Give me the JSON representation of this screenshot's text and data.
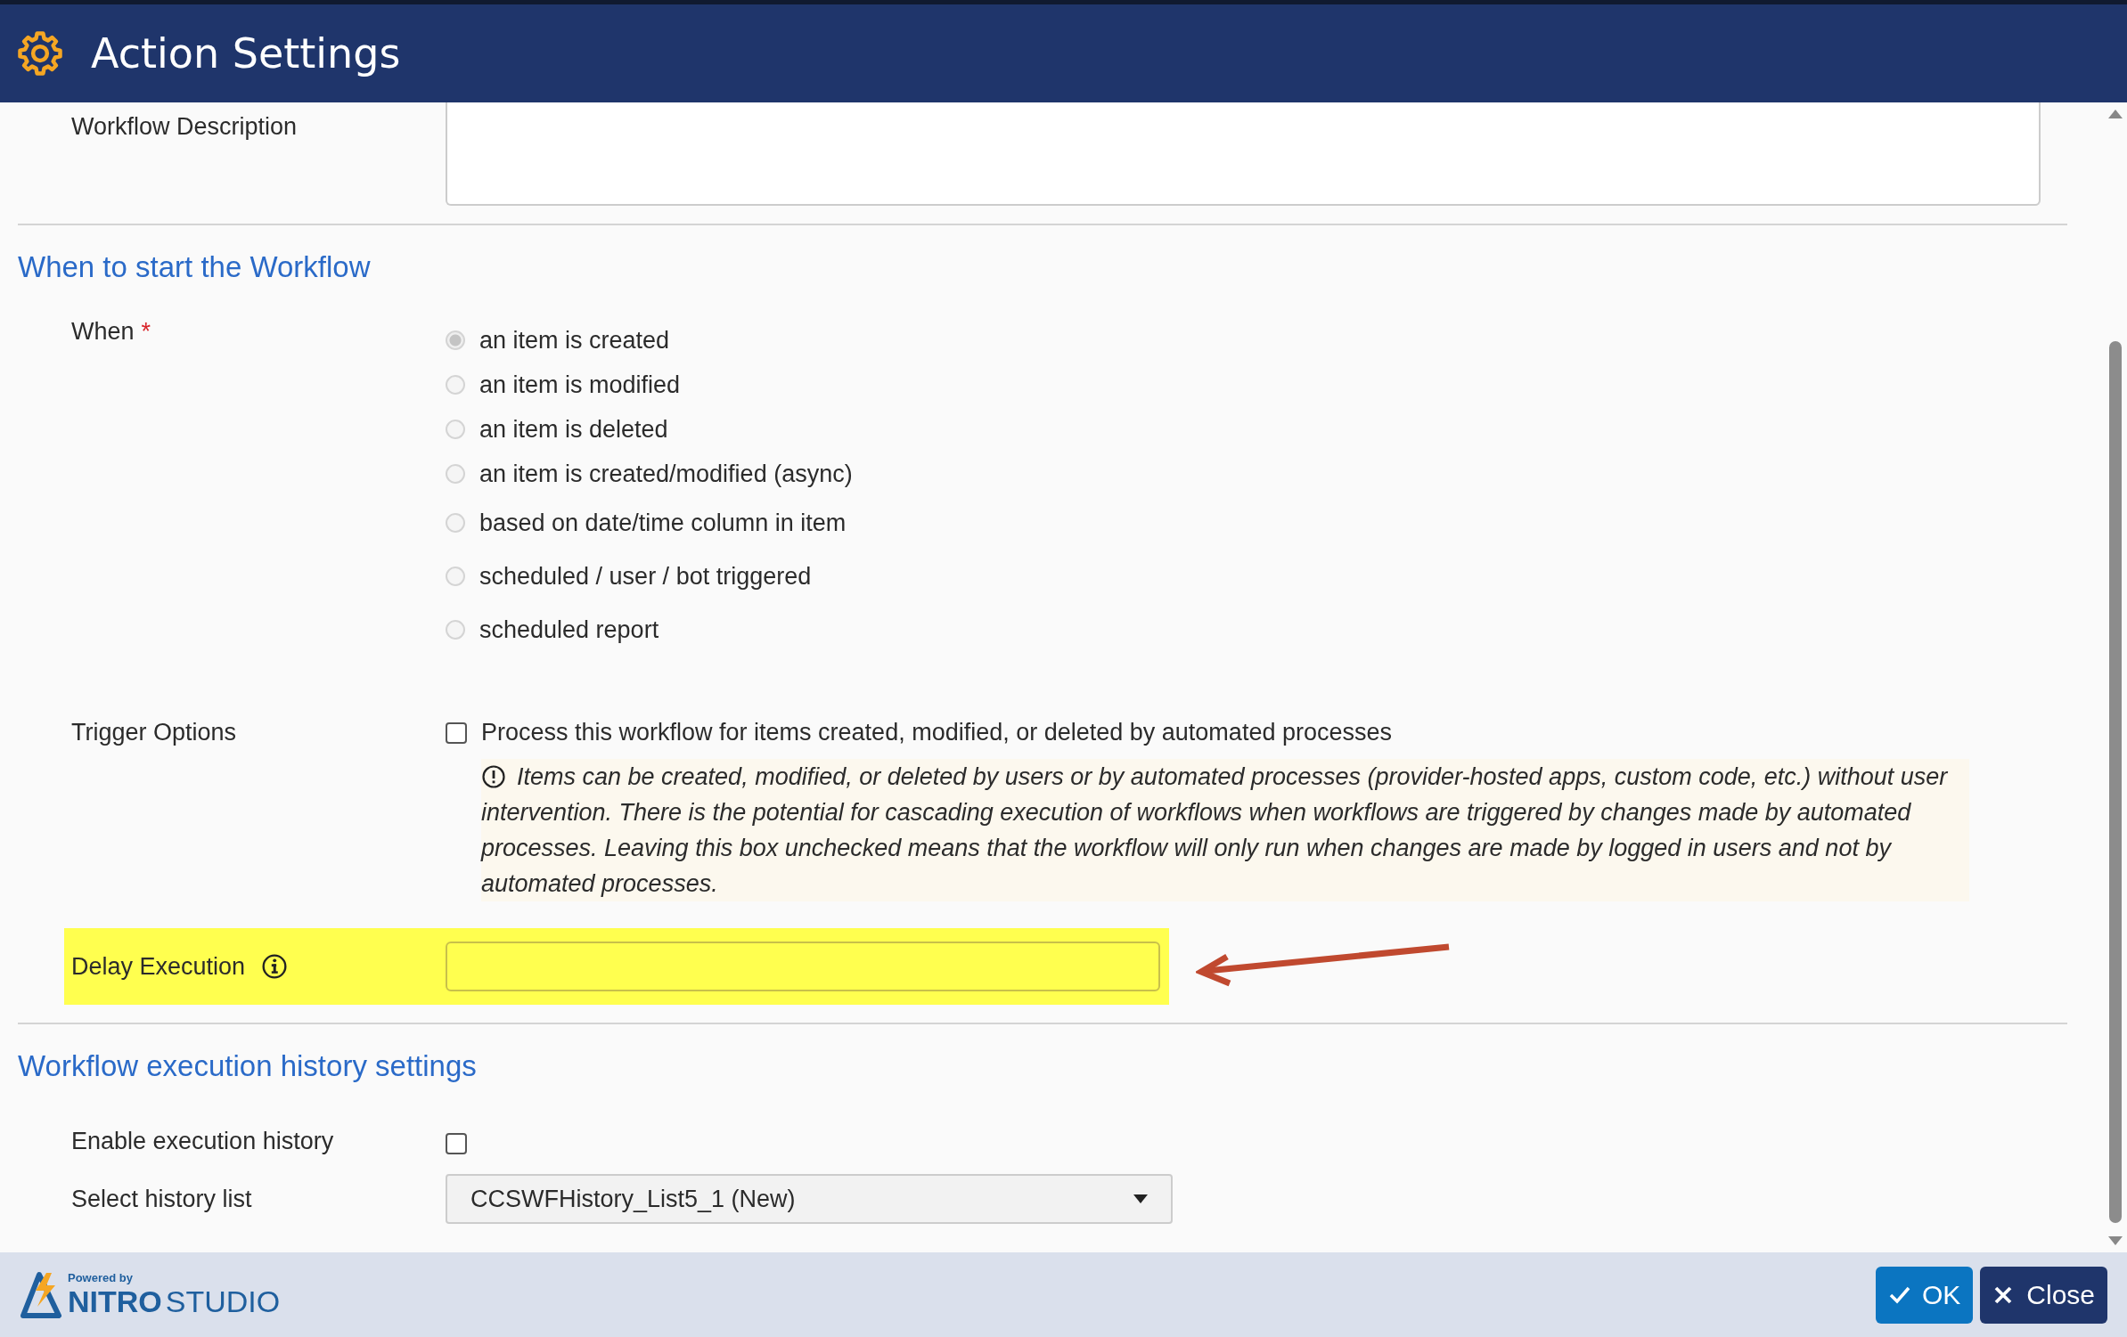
{
  "window": {
    "title": "Action Settings"
  },
  "workflow_description": {
    "label": "Workflow Description"
  },
  "start_section": {
    "title": "When to start the Workflow",
    "when": {
      "label": "When",
      "required_mark": "*",
      "options": [
        {
          "label": "an item is created",
          "selected": true
        },
        {
          "label": "an item is modified",
          "selected": false
        },
        {
          "label": "an item is deleted",
          "selected": false
        },
        {
          "label": "an item is created/modified (async)",
          "selected": false
        },
        {
          "label": "based on date/time column in item",
          "selected": false
        },
        {
          "label": "scheduled / user / bot triggered",
          "selected": false
        },
        {
          "label": "scheduled report",
          "selected": false
        }
      ]
    },
    "trigger_options": {
      "label": "Trigger Options",
      "checkbox": {
        "label": "Process this workflow for items created, modified, or deleted by automated processes",
        "checked": false
      },
      "note": "Items can be created, modified, or deleted by users or by automated processes (provider-hosted apps, custom code, etc.) without user intervention. There is the potential for cascading execution of workflows when workflows are triggered by changes made by automated processes. Leaving this box unchecked means that the workflow will only run when changes are made by logged in users and not by automated processes."
    },
    "delay_execution": {
      "label": "Delay Execution",
      "highlighted": true
    }
  },
  "history_section": {
    "title": "Workflow execution history settings",
    "enable_history": {
      "label": "Enable execution history",
      "checked": false
    },
    "history_list": {
      "label": "Select history list",
      "value": "CCSWFHistory_List5_1 (New)"
    }
  },
  "footer": {
    "logo": {
      "tagline": "Powered by",
      "brand": "NITRO",
      "product": "STUDIO"
    },
    "buttons": [
      {
        "label": "OK",
        "kind": "primary"
      },
      {
        "label": "Close",
        "kind": "secondary"
      }
    ]
  }
}
